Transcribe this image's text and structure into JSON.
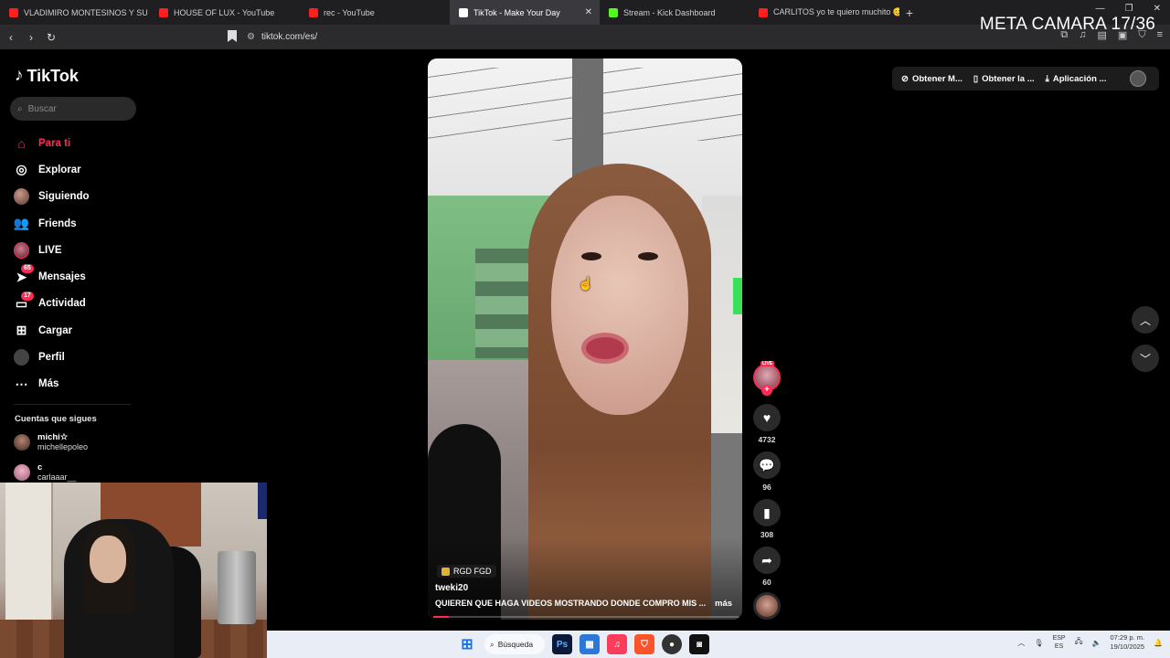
{
  "browser": {
    "tabs": [
      {
        "title": "VLADIMIRO MONTESINOS Y SU OBSESIÓN",
        "color": "#ff1f1f"
      },
      {
        "title": "HOUSE OF LUX - YouTube",
        "color": "#ff1f1f"
      },
      {
        "title": "rec - YouTube",
        "color": "#ff1f1f"
      },
      {
        "title": "TikTok - Make Your Day",
        "color": "#ffffff",
        "active": true
      },
      {
        "title": "Stream - Kick Dashboard",
        "color": "#53fc18"
      },
      {
        "title": "CARLITOS yo te quiero muchito 😊🥹",
        "color": "#ff1f1f"
      }
    ],
    "url": "tiktok.com/es/",
    "overlay_text": "META CAMARA 17/36"
  },
  "sidebar": {
    "logo": "TikTok",
    "search_placeholder": "Buscar",
    "items": [
      {
        "label": "Para ti",
        "icon": "home-icon",
        "active": true
      },
      {
        "label": "Explorar",
        "icon": "compass-icon"
      },
      {
        "label": "Siguiendo",
        "icon": "following-avatar-icon"
      },
      {
        "label": "Friends",
        "icon": "friends-icon"
      },
      {
        "label": "LIVE",
        "icon": "live-icon"
      },
      {
        "label": "Mensajes",
        "icon": "messages-icon",
        "badge": "65"
      },
      {
        "label": "Actividad",
        "icon": "activity-icon",
        "badge": "17"
      },
      {
        "label": "Cargar",
        "icon": "upload-icon"
      },
      {
        "label": "Perfil",
        "icon": "profile-icon"
      },
      {
        "label": "Más",
        "icon": "more-icon"
      }
    ],
    "following_heading": "Cuentas que sigues",
    "following": [
      {
        "name": "michi☆",
        "username": "michellepoleo"
      },
      {
        "name": "c",
        "username": "carlaaar__"
      }
    ]
  },
  "top_actions": {
    "get_coins": "Obtener M...",
    "get_app": "Obtener la ...",
    "desktop_app": "Aplicación ..."
  },
  "video": {
    "tag": "RGD FGD",
    "username": "tweki20",
    "caption": "QUIEREN QUE HAGA VIDEOS MOSTRANDO DONDE COMPRO MIS ...",
    "more": "más",
    "progress": 0.05,
    "live_label": "LIVE",
    "likes": "4732",
    "comments": "96",
    "saves": "308",
    "shares": "60"
  },
  "taskbar": {
    "search_label": "Búsqueda",
    "lang_top": "ESP",
    "lang_bottom": "ES",
    "time": "07:29 p. m.",
    "date": "19/10/2025"
  },
  "colors": {
    "accent": "#fe2c55",
    "background": "#000000"
  }
}
